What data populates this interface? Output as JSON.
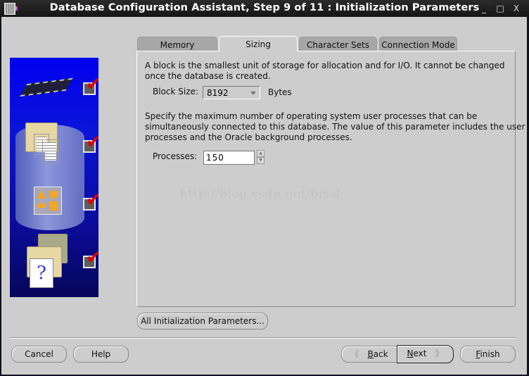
{
  "window": {
    "title": "Database Configuration Assistant, Step 9 of 11 : Initialization Parameters",
    "controls": {
      "minimize": "_",
      "maximize": "□",
      "close": "X"
    }
  },
  "steps": [
    {
      "icon": "memory-chip-icon",
      "completed": true
    },
    {
      "icon": "documents-folder-icon",
      "completed": true
    },
    {
      "icon": "shapes-icon",
      "completed": true
    },
    {
      "icon": "help-document-icon",
      "completed": true
    }
  ],
  "tabs": [
    {
      "label": "Memory",
      "active": false
    },
    {
      "label": "Sizing",
      "active": true
    },
    {
      "label": "Character Sets",
      "active": false
    },
    {
      "label": "Connection Mode",
      "active": false
    }
  ],
  "sizing": {
    "block_description_1": "A block is the smallest unit of storage for allocation and for I/O. It cannot be changed",
    "block_description_2": "once the database is created.",
    "block_size_label": "Block Size:",
    "block_size_value": "8192",
    "block_size_unit": "Bytes",
    "processes_description_1": "Specify the maximum number of operating system user processes that can be",
    "processes_description_2": "simultaneously connected to this database. The value of this parameter includes the user",
    "processes_description_3": "processes and the Oracle background processes.",
    "processes_label": "Processes:",
    "processes_value": "150"
  },
  "watermark": "http://blog.csdn.net/bisal",
  "buttons": {
    "all_params": "All Initialization Parameters...",
    "cancel": "Cancel",
    "help": "Help",
    "back_prefix": "B",
    "back_rest": "ack",
    "next_prefix": "N",
    "next_rest": "ext",
    "finish_prefix": "F",
    "finish_rest": "inish"
  }
}
